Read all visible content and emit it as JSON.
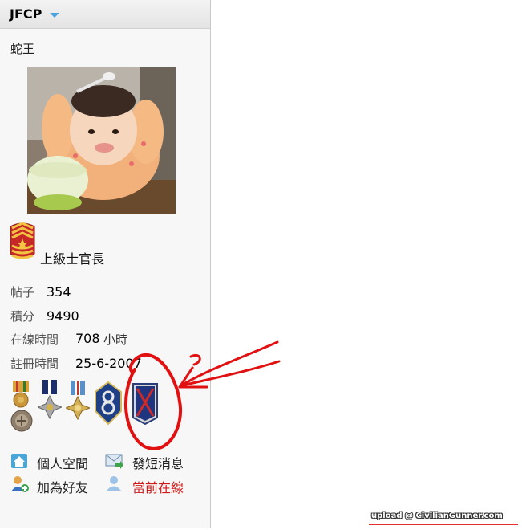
{
  "profile": {
    "username": "JFCP",
    "nickname": "蛇王",
    "rank_title": "上級士官長",
    "stats": {
      "posts_label": "帖子",
      "posts_value": "354",
      "credits_label": "積分",
      "credits_value": "9490",
      "online_label": "在線時間",
      "online_value": "708",
      "online_unit": "小時",
      "reg_label": "註冊時間",
      "reg_value": "25-6-2007"
    }
  },
  "medals": [
    "ribbon-medal-icon",
    "navy-cross-medal-icon",
    "silver-star-medal-icon",
    "8th-division-patch-icon",
    "10th-mountain-division-patch-icon",
    "bronze-round-medal-icon",
    "cross-medal-icon",
    "star-cross-medal-icon"
  ],
  "actions": {
    "home_space": "個人空間",
    "send_message": "發短消息",
    "add_friend": "加為好友",
    "online_status": "當前在線"
  },
  "colors": {
    "online_status": "#d11a1a",
    "annotation": "#e11111",
    "caret": "#4aa3df"
  },
  "watermark": "upload @ CivilianGunner.com"
}
